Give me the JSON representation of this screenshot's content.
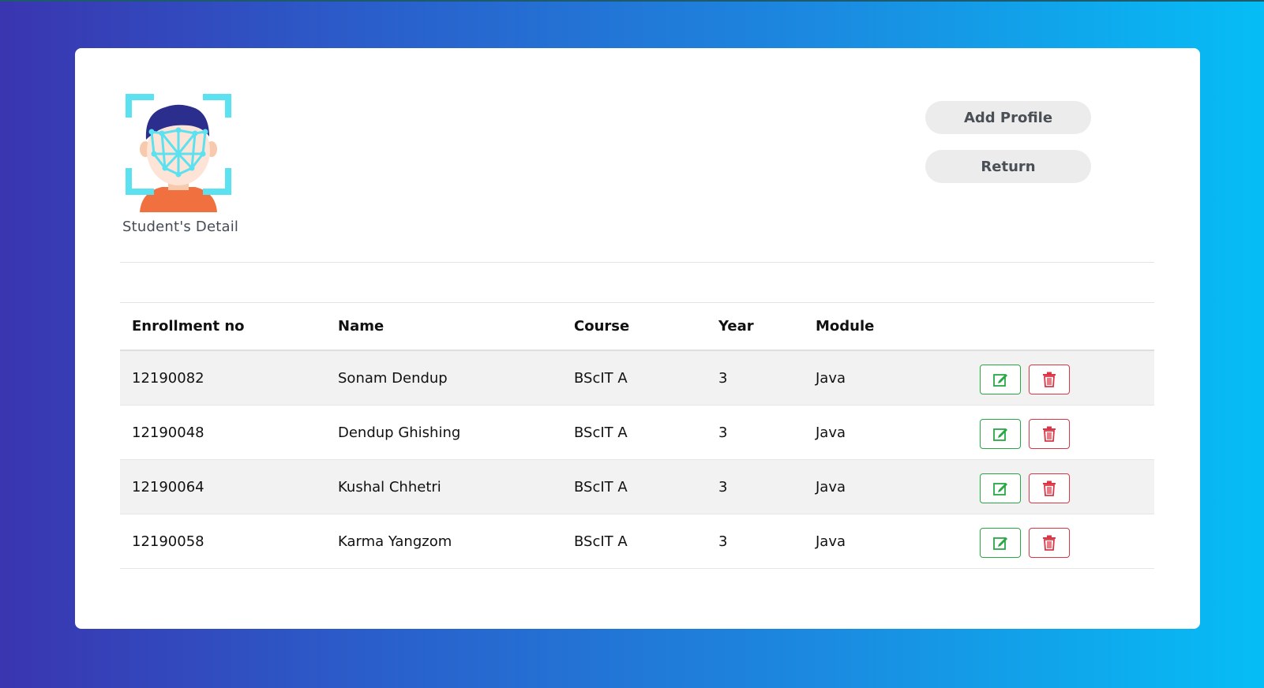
{
  "page": {
    "caption": "Student's Detail"
  },
  "header": {
    "add_profile_label": "Add Profile",
    "return_label": "Return"
  },
  "table": {
    "columns": [
      "Enrollment no",
      "Name",
      "Course",
      "Year",
      "Module"
    ],
    "rows": [
      {
        "enrollment": "12190082",
        "name": "Sonam Dendup",
        "course": "BScIT A",
        "year": "3",
        "module": "Java"
      },
      {
        "enrollment": "12190048",
        "name": "Dendup Ghishing",
        "course": "BScIT A",
        "year": "3",
        "module": "Java"
      },
      {
        "enrollment": "12190064",
        "name": "Kushal Chhetri",
        "course": "BScIT A",
        "year": "3",
        "module": "Java"
      },
      {
        "enrollment": "12190058",
        "name": "Karma Yangzom",
        "course": "BScIT A",
        "year": "3",
        "module": "Java"
      }
    ],
    "row_icons": [
      "edit-icon",
      "trash-icon"
    ]
  },
  "colors": {
    "background_start": "#3a35b0",
    "background_end": "#06bdf5",
    "edit": "#28a745",
    "delete": "#dc3545",
    "face_scan": "#5ce1f0"
  }
}
